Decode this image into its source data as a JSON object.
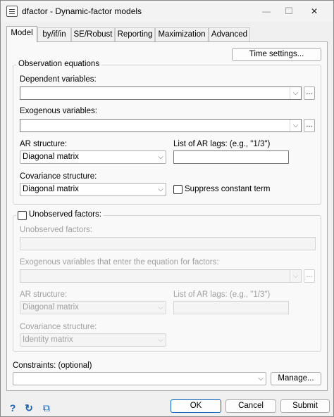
{
  "window": {
    "title": "dfactor - Dynamic-factor models",
    "minimize": "—",
    "maximize": "☐",
    "close": "✕"
  },
  "tabs": [
    "Model",
    "by/if/in",
    "SE/Robust",
    "Reporting",
    "Maximization",
    "Advanced"
  ],
  "active_tab": "Model",
  "time_settings_label": "Time settings...",
  "observation": {
    "legend": "Observation equations",
    "dependent_label": "Dependent variables:",
    "dependent_value": "",
    "exogenous_label": "Exogenous variables:",
    "exogenous_value": "",
    "ar_structure_label": "AR structure:",
    "ar_structure_value": "Diagonal matrix",
    "ar_lags_label": "List of AR lags: (e.g., \"1/3\")",
    "ar_lags_value": "",
    "cov_structure_label": "Covariance structure:",
    "cov_structure_value": "Diagonal matrix",
    "suppress_constant_label": "Suppress constant term",
    "suppress_constant_checked": false
  },
  "unobserved": {
    "checkbox_label": "Unobserved factors:",
    "checked": false,
    "factors_label": "Unobserved factors:",
    "factors_value": "",
    "exog_label": "Exogenous variables that enter the equation for factors:",
    "exog_value": "",
    "ar_structure_label": "AR structure:",
    "ar_structure_value": "Diagonal matrix",
    "ar_lags_label": "List of AR lags: (e.g., \"1/3\")",
    "ar_lags_value": "",
    "cov_structure_label": "Covariance structure:",
    "cov_structure_value": "Identity matrix"
  },
  "constraints": {
    "label": "Constraints: (optional)",
    "value": "",
    "manage_label": "Manage..."
  },
  "ellipsis": "...",
  "dropdown_arrow": "⌵",
  "footer": {
    "help_icon": "?",
    "reset_icon": "↻",
    "copy_icon": "⧉",
    "ok_label": "OK",
    "cancel_label": "Cancel",
    "submit_label": "Submit"
  }
}
